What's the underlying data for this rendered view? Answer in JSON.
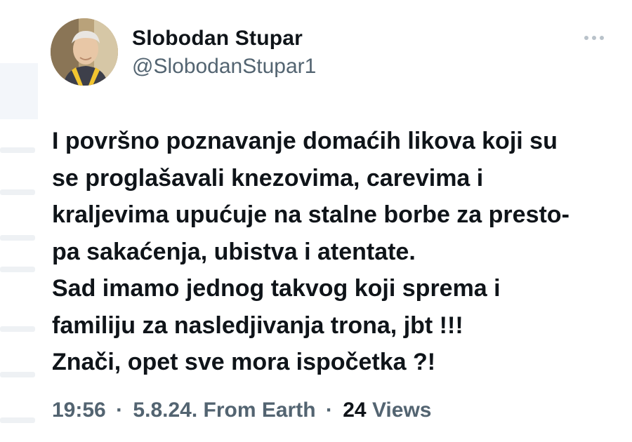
{
  "author": {
    "display_name": "Slobodan Stupar",
    "handle": "@SlobodanStupar1",
    "avatar_icon": "profile-photo"
  },
  "more_icon": "more-dots-icon",
  "tweet": {
    "lines": [
      "I površno poznavanje domaćih likova koji su",
      "se proglašavali knezovima, carevima i",
      "kraljevima upućuje na stalne borbe za presto-",
      "pa sakaćenja, ubistva i atentate.",
      "Sad imamo jednog takvog koji sprema i",
      "familiju za nasledjivanja trona, jbt !!!",
      "Znači, opet sve mora ispočetka ?!"
    ]
  },
  "meta": {
    "time": "19:56",
    "date": "5.8.24.",
    "source": "From Earth",
    "separator": "·",
    "views_count": "24",
    "views_label": "Views"
  },
  "colors": {
    "text_primary": "#0f1419",
    "text_secondary": "#536471",
    "background": "#ffffff"
  }
}
